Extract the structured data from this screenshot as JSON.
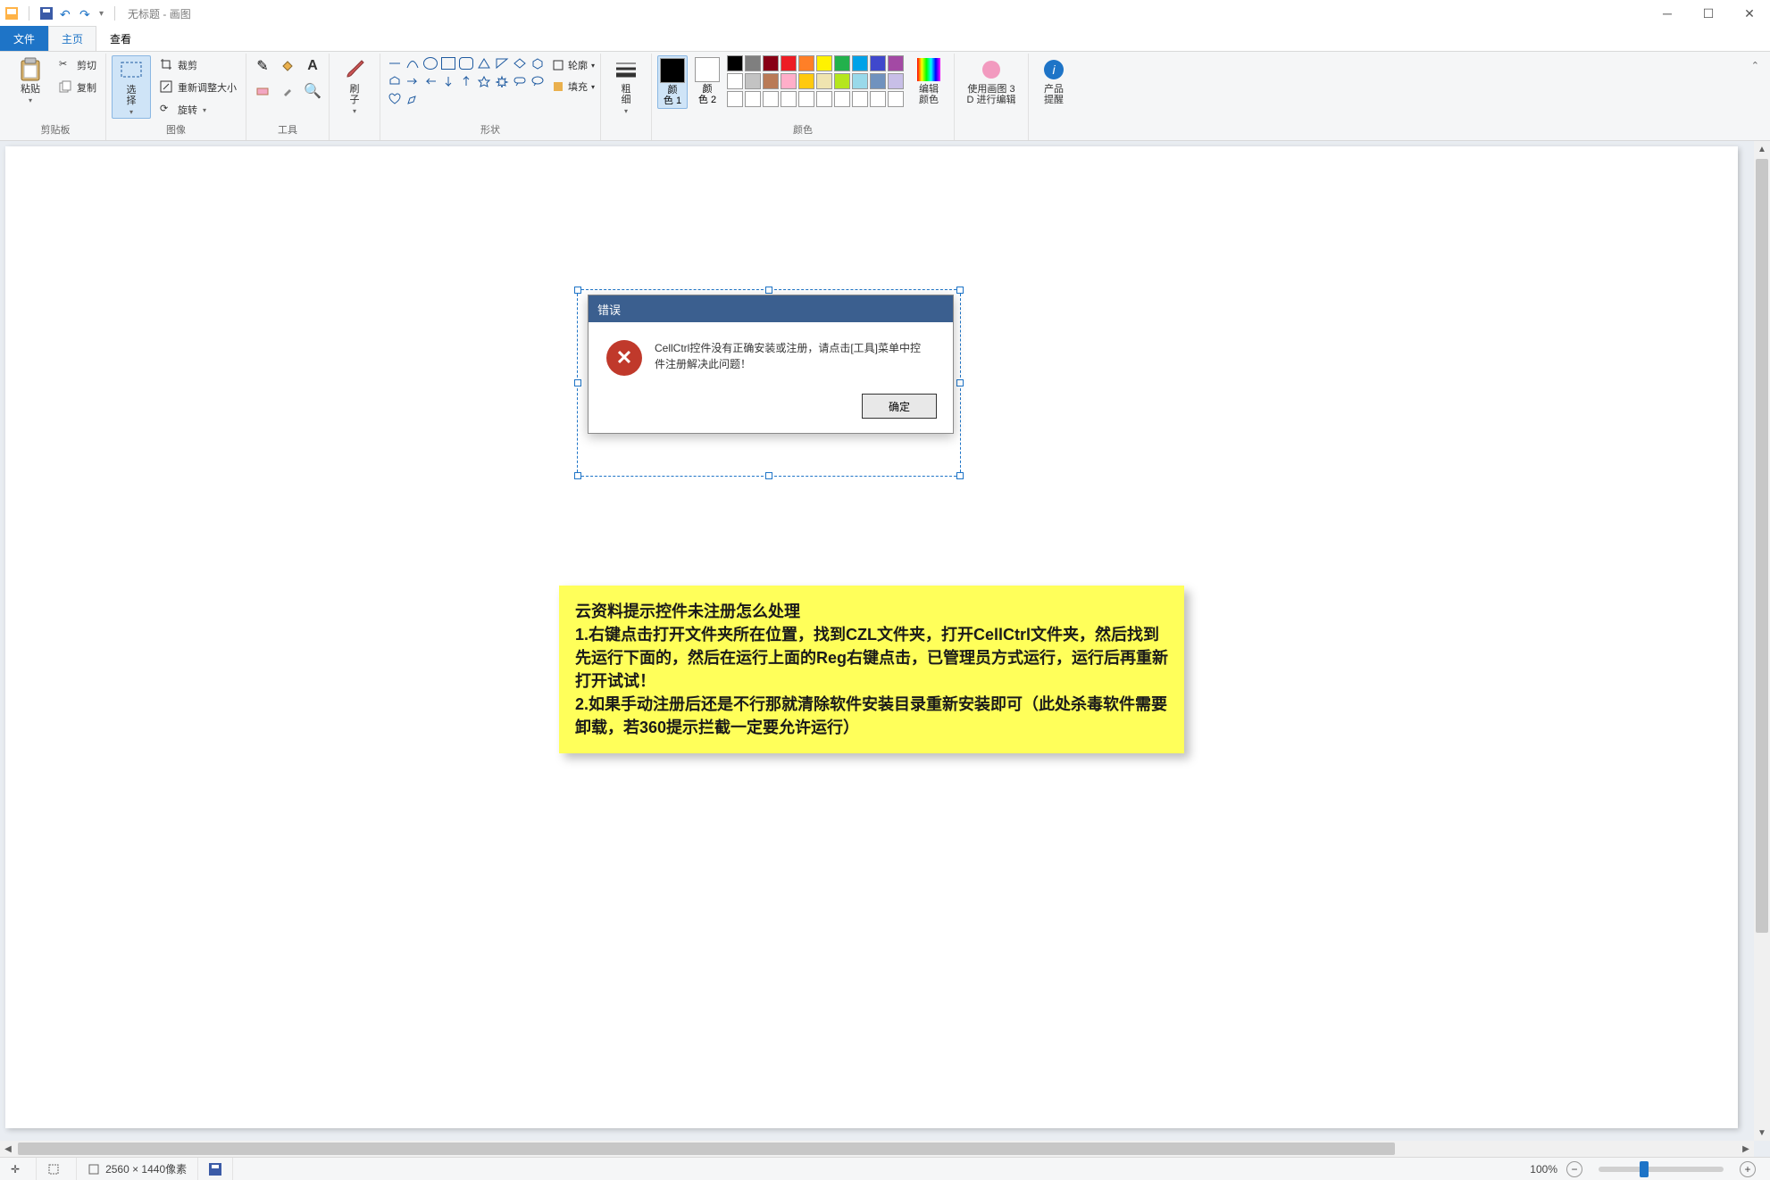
{
  "app": {
    "title": "无标题 - 画图"
  },
  "qat": {
    "save": "保存",
    "undo": "撤销",
    "redo": "重做"
  },
  "tabs": {
    "file": "文件",
    "home": "主页",
    "view": "查看"
  },
  "ribbon": {
    "clipboard": {
      "paste": "粘贴",
      "cut": "剪切",
      "copy": "复制",
      "label": "剪贴板"
    },
    "image": {
      "select": "选\n择",
      "crop": "裁剪",
      "resize": "重新调整大小",
      "rotate": "旋转",
      "label": "图像"
    },
    "tools": {
      "label": "工具",
      "pencil": "铅笔",
      "fill": "填充",
      "text": "文本",
      "eraser": "橡皮擦",
      "picker": "取色器",
      "magnifier": "放大镜"
    },
    "brushes": {
      "btn": "刷\n子",
      "label": ""
    },
    "shapes": {
      "outline": "轮廓",
      "fill": "填充",
      "label": "形状"
    },
    "stroke": {
      "btn": "粗\n细"
    },
    "colors": {
      "c1": "颜\n色 1",
      "c2": "颜\n色 2",
      "edit": "编辑\n颜色",
      "label": "颜色",
      "row1": [
        "#000000",
        "#7f7f7f",
        "#880015",
        "#ed1c24",
        "#ff7f27",
        "#fff200",
        "#22b14c",
        "#00a2e8",
        "#3f48cc",
        "#a349a4"
      ],
      "row2": [
        "#ffffff",
        "#c3c3c3",
        "#b97a57",
        "#ffaec9",
        "#ffc90e",
        "#efe4b0",
        "#b5e61d",
        "#99d9ea",
        "#7092be",
        "#c8bfe7"
      ],
      "row3": [
        "#ffffff",
        "#ffffff",
        "#ffffff",
        "#ffffff",
        "#ffffff",
        "#ffffff",
        "#ffffff",
        "#ffffff",
        "#ffffff",
        "#ffffff"
      ]
    },
    "paint3d": {
      "btn": "使用画图 3\nD 进行编辑"
    },
    "alert": {
      "btn": "产品\n提醒"
    }
  },
  "dialog": {
    "title": "错误",
    "msg": "CellCtrl控件没有正确安装或注册，请点击[工具]菜单中控件注册解决此问题！",
    "ok": "确定"
  },
  "sticky": {
    "title": "云资料提示控件未注册怎么处理",
    "l1": "1.右键点击打开文件夹所在位置，找到CZL文件夹，打开CellCtrl文件夹，然后找到先运行下面的，然后在运行上面的Reg右键点击，已管理员方式运行，运行后再重新打开试试！",
    "l2": "2.如果手动注册后还是不行那就清除软件安装目录重新安装即可（此处杀毒软件需要卸载，若360提示拦截一定要允许运行）"
  },
  "status": {
    "size": "2560 × 1440像素",
    "zoom": "100%"
  }
}
